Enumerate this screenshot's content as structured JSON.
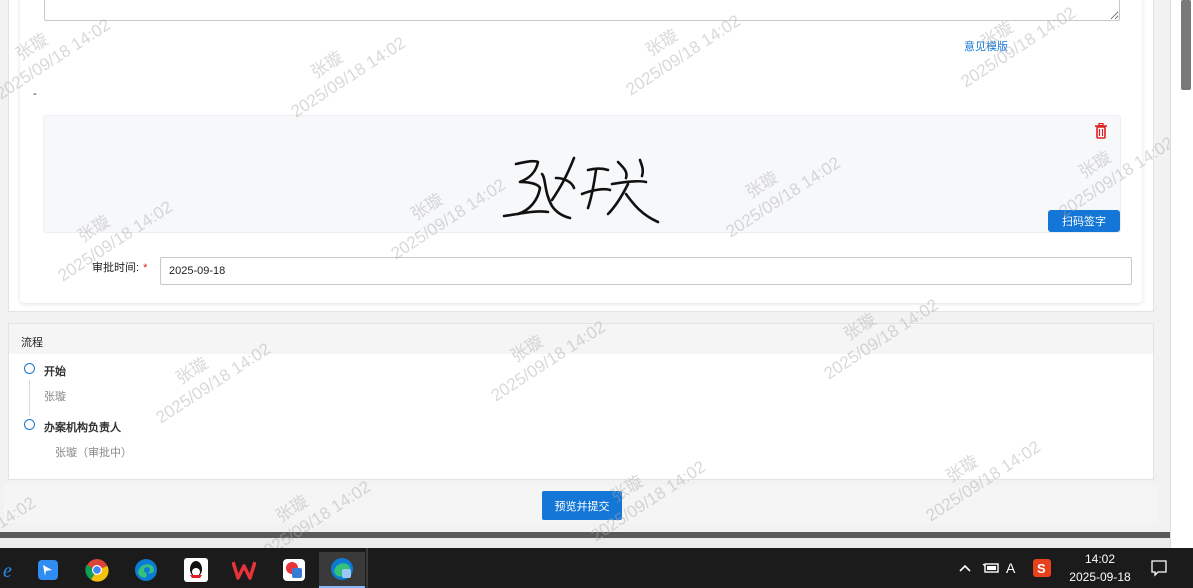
{
  "form": {
    "opinion_template_link": "意见模版",
    "dash_label": "-",
    "signature_name": "张璇",
    "scan_sign_button": "扫码签字",
    "approval_time_label": "审批时间:",
    "required_mark": "*",
    "approval_time_value": "2025-09-18"
  },
  "process": {
    "title": "流程",
    "steps": [
      {
        "name": "开始",
        "person": "张璇"
      },
      {
        "name": "办案机构负责人",
        "person": "张璇（审批中）"
      }
    ]
  },
  "footer": {
    "preview_submit_button": "预览并提交"
  },
  "watermark": {
    "name": "张璇",
    "datetime": "2025/09/18 14:02"
  },
  "taskbar": {
    "apps": [
      "ie-icon",
      "feishu-icon",
      "chrome-icon",
      "edge-icon",
      "qq-icon",
      "wps-icon",
      "app-icon",
      "edge-app-icon"
    ],
    "tray_letter": "A",
    "tray_sogou": "S",
    "clock_time": "14:02",
    "clock_date": "2025-09-18"
  },
  "colors": {
    "accent": "#1476d6",
    "danger": "#e02020",
    "taskbar": "#1b1b1b"
  }
}
